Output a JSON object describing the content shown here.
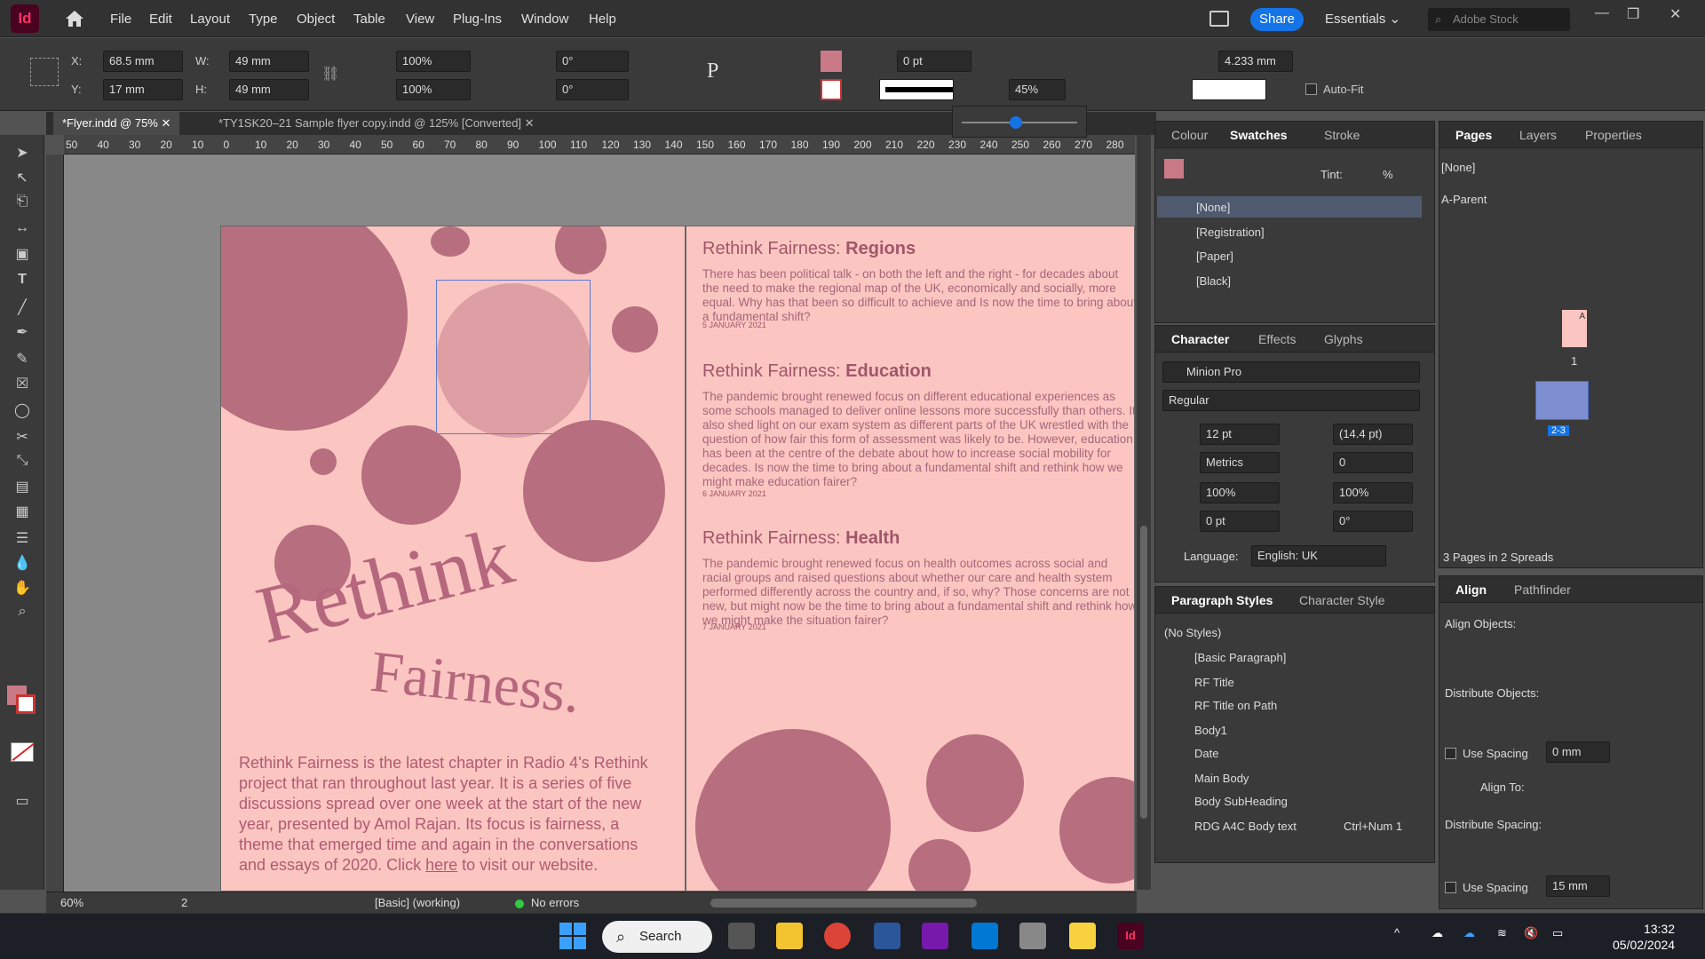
{
  "app": {
    "logo": "Id"
  },
  "menu": [
    "File",
    "Edit",
    "Layout",
    "Type",
    "Object",
    "Table",
    "View",
    "Plug-Ins",
    "Window",
    "Help"
  ],
  "header": {
    "share": "Share",
    "workspace": "Essentials",
    "stock_placeholder": "Adobe Stock"
  },
  "control": {
    "x_label": "X:",
    "x": "68.5 mm",
    "y_label": "Y:",
    "y": "17 mm",
    "w_label": "W:",
    "w": "49 mm",
    "h_label": "H:",
    "h": "49 mm",
    "scale_x": "100%",
    "scale_y": "100%",
    "rotate": "0°",
    "shear": "0°",
    "stroke_weight": "0 pt",
    "opacity": "45%",
    "ref_value": "4.233 mm",
    "autofit": "Auto-Fit"
  },
  "tabs": [
    "*Flyer.indd @ 75%",
    "*TY1SK20–21 Sample flyer copy.indd @ 125% [Converted]"
  ],
  "ruler": {
    "ticks": [
      "50",
      "40",
      "30",
      "20",
      "10",
      "0",
      "10",
      "20",
      "30",
      "40",
      "50",
      "60",
      "70",
      "80",
      "90",
      "100",
      "110",
      "120",
      "130",
      "140",
      "150",
      "160",
      "170",
      "180",
      "190",
      "200",
      "210",
      "220",
      "230",
      "240",
      "250",
      "260",
      "270",
      "280"
    ]
  },
  "left_page": {
    "title1": "Rethink",
    "title2": "Fairness.",
    "body_pre": "Rethink Fairness is the latest chapter in Radio 4's Rethink project that ran throughout last year. It is a series of five discussions spread over one week at the start of the new year, presented by Amol Rajan. Its focus is fairness, a theme that emerged time and again in the conversations and essays of 2020. Click ",
    "body_link": "here",
    "body_post": " to visit our website."
  },
  "articles": [
    {
      "heading_pre": "Rethink Fairness: ",
      "heading_bold": "Regions",
      "body": "There has been political talk - on both the left and the right - for decades about the need to make the regional map of the UK, economically and socially, more equal. Why has that been so difficult to achieve and Is now the time to bring about a fundamental shift?",
      "date": "5 JANUARY 2021"
    },
    {
      "heading_pre": "Rethink Fairness: ",
      "heading_bold": "Education",
      "body": "The pandemic brought renewed focus on different educational experiences as some schools managed to deliver online lessons more successfully than others. It also shed light on our exam system as different parts of the UK wrestled with the question of how fair this form of assessment was likely to be. However, education has been at the centre of the debate about how to increase social mobility for decades. Is now the time to bring about a fundamental shift and rethink how we might make education fairer?",
      "date": "6 JANUARY 2021"
    },
    {
      "heading_pre": "Rethink Fairness: ",
      "heading_bold": "Health",
      "body": "The pandemic brought renewed focus on health outcomes across social and racial groups and raised questions about whether our care and health system performed differently across the country and, if so, why? Those concerns are not new, but might now be the time to bring about a fundamental shift and rethink how we might make the situation fairer?",
      "date": "7 JANUARY 2021"
    }
  ],
  "status": {
    "zoom": "60%",
    "page": "2",
    "style": "[Basic] (working)",
    "errors": "No errors"
  },
  "swatches": {
    "tabs": [
      "Colour",
      "Swatches",
      "Stroke"
    ],
    "tint_label": "Tint:",
    "percent": "%",
    "items": [
      "[None]",
      "[Registration]",
      "[Paper]",
      "[Black]"
    ]
  },
  "character": {
    "tabs": [
      "Character",
      "Effects",
      "Glyphs"
    ],
    "font": "Minion Pro",
    "style": "Regular",
    "size": "12 pt",
    "leading": "(14.4 pt)",
    "kerning": "Metrics",
    "tracking": "0",
    "vscale": "100%",
    "hscale": "100%",
    "baseline": "0 pt",
    "skew": "0°",
    "language_label": "Language:",
    "language": "English: UK"
  },
  "paragraph": {
    "tabs": [
      "Paragraph Styles",
      "Character Style"
    ],
    "items": [
      "(No Styles)",
      "[Basic Paragraph]",
      "RF Title",
      "RF Title on Path",
      "Body1",
      "Date",
      "Main Body",
      "Body SubHeading",
      "RDG A4C Body text"
    ],
    "shortcut": "Ctrl+Num 1"
  },
  "pages": {
    "tabs": [
      "Pages",
      "Layers",
      "Properties"
    ],
    "none": "[None]",
    "parent": "A-Parent",
    "page1": "1",
    "spread": "2-3",
    "a": "A",
    "summary": "3 Pages in 2 Spreads"
  },
  "align": {
    "tabs": [
      "Align",
      "Pathfinder"
    ],
    "align_objects": "Align Objects:",
    "distribute_objects": "Distribute Objects:",
    "use_spacing": "Use Spacing",
    "spacing1": "0 mm",
    "align_to": "Align To:",
    "distribute_spacing": "Distribute Spacing:",
    "spacing2": "15 mm"
  },
  "taskbar": {
    "search": "Search",
    "time": "13:32",
    "date": "05/02/2024"
  },
  "colors": {
    "accent": "#1473e6",
    "page": "#fbc6c1",
    "circle": "#b76e7e",
    "text": "#a0566a"
  }
}
